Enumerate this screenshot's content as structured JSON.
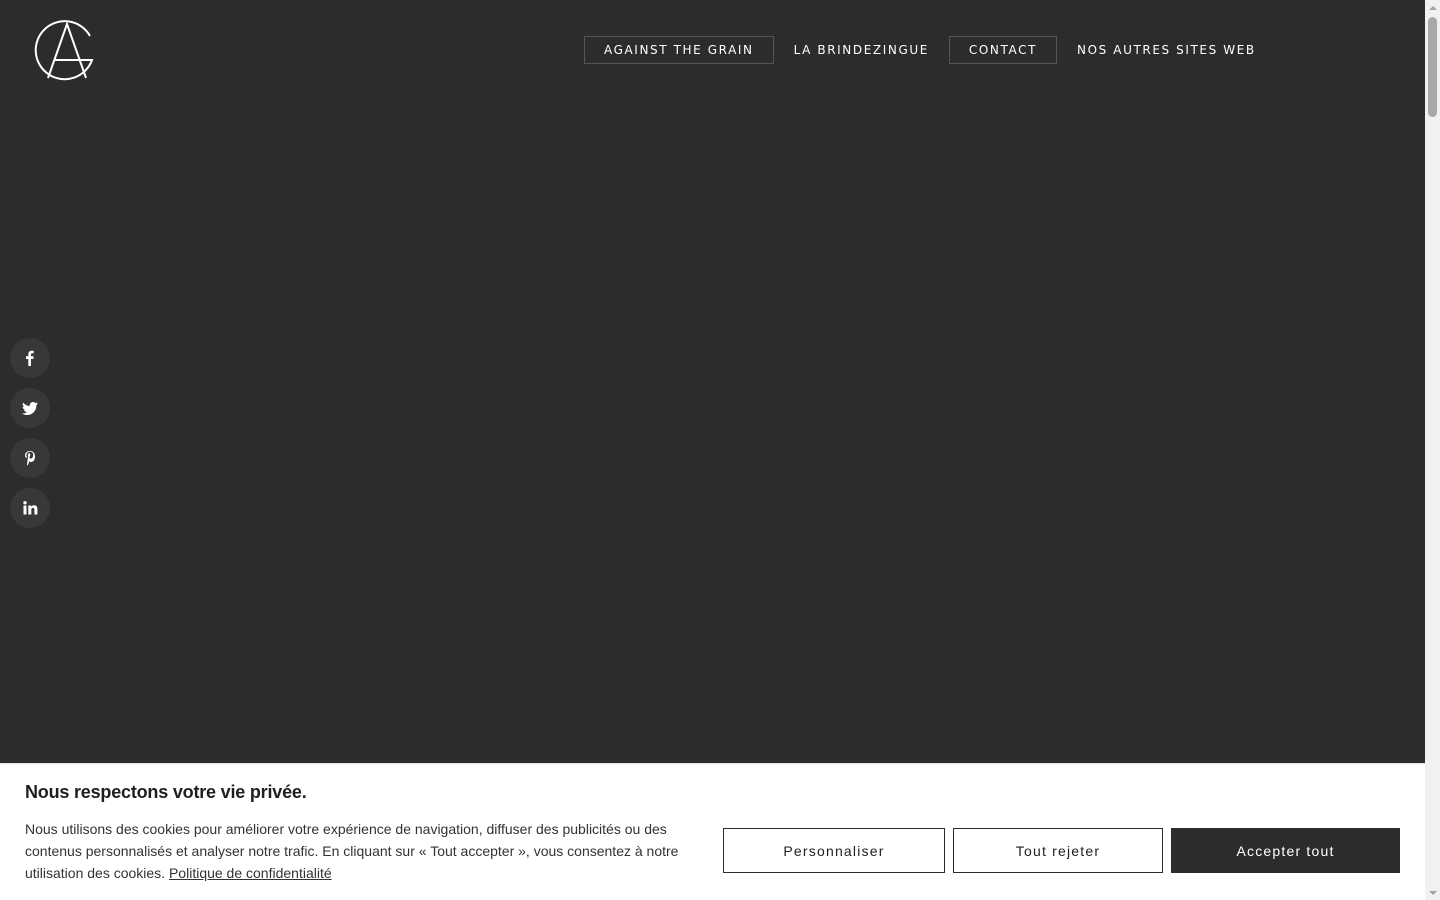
{
  "logo": {
    "icon": "ag-monogram-logo"
  },
  "nav": {
    "items": [
      {
        "label": "AGAINST THE GRAIN"
      },
      {
        "label": "LA BRINDEZINGUE"
      },
      {
        "label": "CONTACT"
      },
      {
        "label": "NOS AUTRES SITES WEB"
      }
    ]
  },
  "social": {
    "items": [
      {
        "icon": "facebook-icon"
      },
      {
        "icon": "twitter-icon"
      },
      {
        "icon": "pinterest-icon"
      },
      {
        "icon": "linkedin-icon"
      }
    ]
  },
  "cookie_banner": {
    "title": "Nous respectons votre vie privée.",
    "text": "Nous utilisons des cookies pour améliorer votre expérience de navigation, diffuser des publicités ou des contenus personnalisés et analyser notre trafic. En cliquant sur « Tout accepter », vous consentez à notre utilisation des cookies.",
    "policy_link": "Politique de confidentialité",
    "buttons": {
      "customize": "Personnaliser",
      "reject_all": "Tout rejeter",
      "accept_all": "Accepter tout"
    }
  },
  "colors": {
    "background": "#2c2c2c",
    "banner": "#ffffff",
    "accent_dark": "#2c2c2c"
  }
}
